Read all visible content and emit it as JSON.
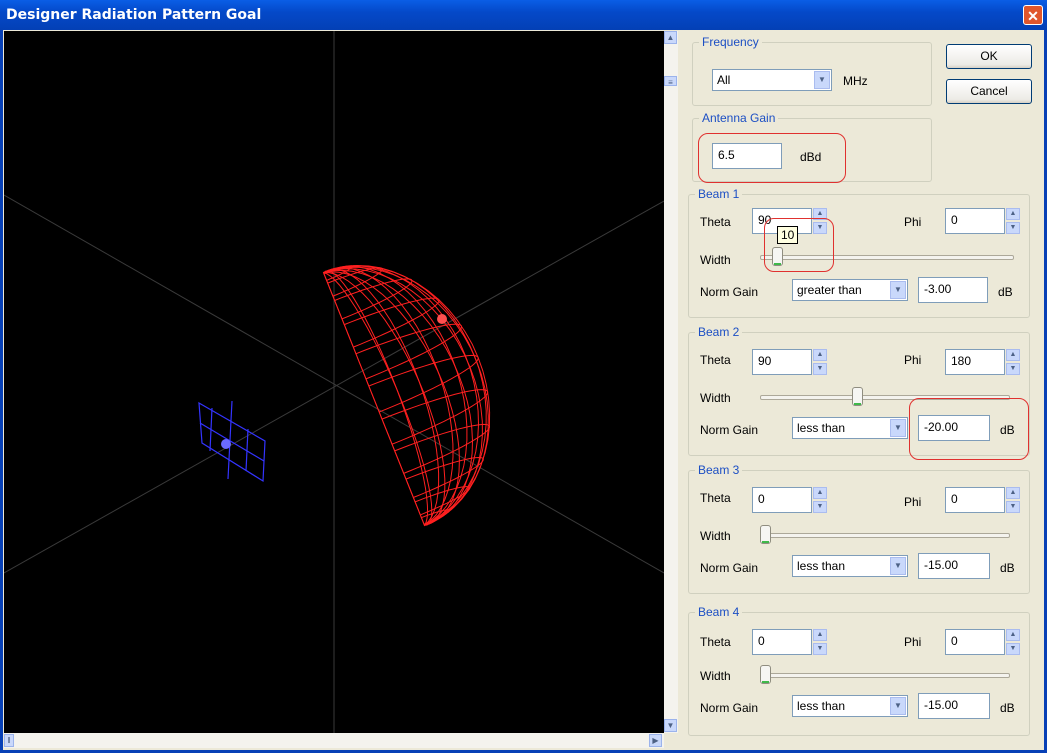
{
  "window": {
    "title": "Designer Radiation Pattern Goal",
    "close_glyph": "✕"
  },
  "buttons": {
    "ok": "OK",
    "cancel": "Cancel"
  },
  "frequency": {
    "legend": "Frequency",
    "value": "All",
    "unit": "MHz"
  },
  "antenna_gain": {
    "legend": "Antenna Gain",
    "value": "6.5",
    "unit": "dBd"
  },
  "labels": {
    "theta": "Theta",
    "phi": "Phi",
    "width": "Width",
    "norm_gain": "Norm Gain",
    "db": "dB"
  },
  "beams": [
    {
      "legend": "Beam 1",
      "theta": "90",
      "phi": "0",
      "width_level": 0.05,
      "comparison": "greater than",
      "gain": "-3.00",
      "tooltip": "10"
    },
    {
      "legend": "Beam 2",
      "theta": "90",
      "phi": "180",
      "width_level": 0.39,
      "comparison": "less than",
      "gain": "-20.00"
    },
    {
      "legend": "Beam 3",
      "theta": "0",
      "phi": "0",
      "width_level": 0.0,
      "comparison": "less than",
      "gain": "-15.00"
    },
    {
      "legend": "Beam 4",
      "theta": "0",
      "phi": "0",
      "width_level": 0.0,
      "comparison": "less than",
      "gain": "-15.00"
    }
  ],
  "colors": {
    "pattern": "#ff2020",
    "target_marker": "#5a5aff",
    "highlight": "#e0312f",
    "legend_blue": "#1c4fc4"
  }
}
